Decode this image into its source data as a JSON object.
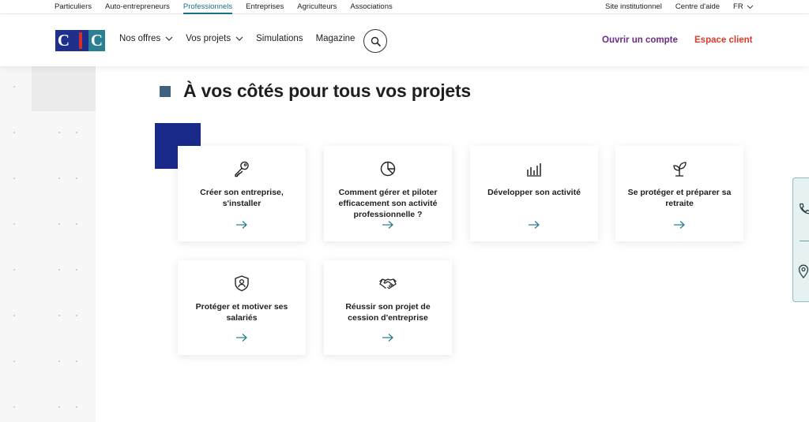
{
  "topbar": {
    "left_links": [
      "Particuliers",
      "Auto-entrepreneurs",
      "Professionnels",
      "Entreprises",
      "Agriculteurs",
      "Associations"
    ],
    "active_link": "Professionnels",
    "site_link": "Site institutionnel",
    "help_link": "Centre d'aide",
    "lang": "FR"
  },
  "header": {
    "logo_text": "CIC",
    "nav": {
      "offers": "Nos offres",
      "projects": "Vos projets",
      "simulations": "Simulations",
      "magazine": "Magazine"
    },
    "open_account": "Ouvrir un compte",
    "client_space": "Espace client"
  },
  "main": {
    "title": "À vos côtés pour tous vos projets",
    "cards": [
      {
        "label": "Créer son entreprise, s'installer",
        "icon": "key-icon"
      },
      {
        "label": "Comment gérer et piloter efficacement son activité professionnelle ?",
        "icon": "pie-chart-icon"
      },
      {
        "label": "Développer son activité",
        "icon": "bar-chart-icon"
      },
      {
        "label": "Se protéger et préparer sa retraite",
        "icon": "sprout-icon"
      },
      {
        "label": "Protéger et motiver ses salariés",
        "icon": "shield-user-icon"
      },
      {
        "label": "Réussir son projet de cession d'entreprise",
        "icon": "handshake-icon"
      }
    ]
  },
  "side_widget": {
    "icons": [
      "phone-icon",
      "location-pin-icon"
    ]
  },
  "colors": {
    "accent_teal": "#18738a",
    "title_square": "#3e6280",
    "deco_blue": "#1a2a8a",
    "open_account": "#6a2c86",
    "client_space": "#d73c2c",
    "arrow": "#2a7f93"
  }
}
